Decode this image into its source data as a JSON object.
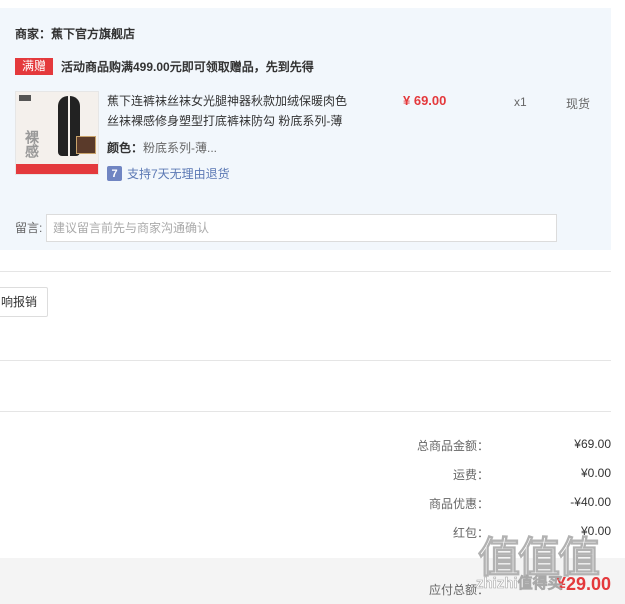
{
  "shop": {
    "name": "商家：蕉下官方旗舰店",
    "promo_badge": "满赠",
    "promo_text": "活动商品购满499.00元即可领取赠品，先到先得"
  },
  "item": {
    "thumb_label": "裸感",
    "title": "蕉下连裤袜丝袜女光腿神器秋款加绒保暖肉色丝袜裸感修身塑型打底裤袜防勾 粉底系列-薄",
    "price": "¥ 69.00",
    "quantity": "x1",
    "stock": "现货",
    "spec_label": "颜色：",
    "spec_value": "粉底系列-薄...",
    "return_icon": "7",
    "return_text": "支持7天无理由退货"
  },
  "message": {
    "label": "留言:",
    "placeholder": "建议留言前先与商家沟通确认"
  },
  "invoice": {
    "button_label": "响报销"
  },
  "summary": [
    {
      "label": "总商品金额：",
      "value": "¥69.00"
    },
    {
      "label": "运费：",
      "value": "¥0.00"
    },
    {
      "label": "商品优惠：",
      "value": "-¥40.00"
    },
    {
      "label": "红包：",
      "value": "¥0.00"
    }
  ],
  "total": {
    "label": "应付总额：",
    "value": "¥29.00"
  },
  "watermark": {
    "glyphs": "值值值",
    "text": "zhizhi值得买"
  },
  "colors": {
    "accent": "#e4393c",
    "panel": "#f2f7fc",
    "link": "#5b78b4"
  }
}
